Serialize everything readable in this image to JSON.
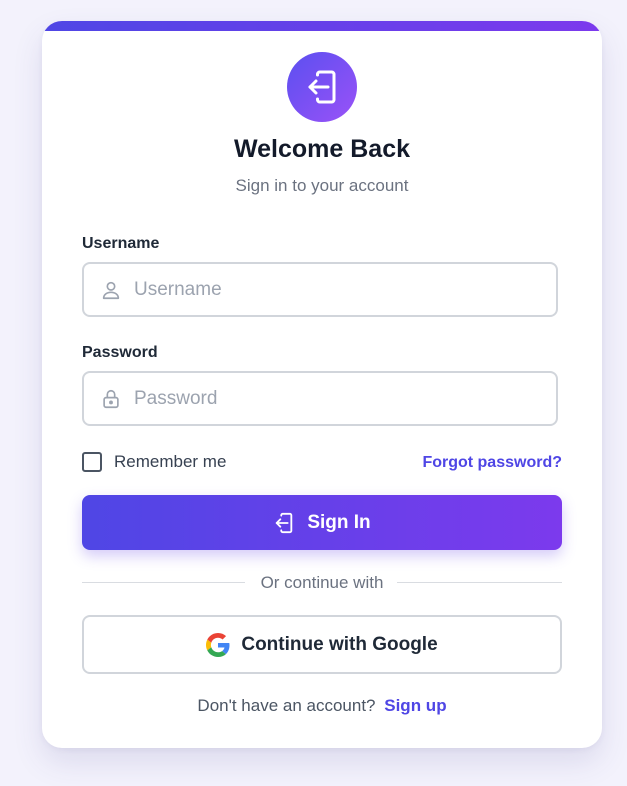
{
  "header": {
    "logo_icon": "sign-in-icon",
    "title": "Welcome Back",
    "subtitle": "Sign in to your account"
  },
  "form": {
    "username": {
      "label": "Username",
      "placeholder": "Username",
      "value": "",
      "icon": "user-icon"
    },
    "password": {
      "label": "Password",
      "placeholder": "Password",
      "value": "",
      "icon": "lock-icon"
    },
    "remember_label": "Remember me",
    "remember_checked": false,
    "forgot_label": "Forgot password?",
    "submit_label": "Sign In",
    "submit_icon": "sign-in-icon"
  },
  "alt_auth": {
    "divider_text": "Or continue with",
    "google_label": "Continue with Google",
    "google_icon": "google-icon"
  },
  "footer": {
    "prompt": "Don't have an account?",
    "signup_label": "Sign up"
  },
  "colors": {
    "accent": "#4f46e5",
    "accent_end": "#7c3aed",
    "page_bg": "#f3f2fc"
  }
}
